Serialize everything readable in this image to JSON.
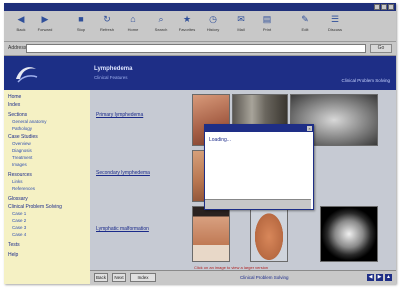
{
  "window": {
    "title": ""
  },
  "toolbar": {
    "buttons": [
      {
        "label": "Back",
        "icon": "back-arrow-icon"
      },
      {
        "label": "Forward",
        "icon": "forward-arrow-icon"
      },
      {
        "label": "Stop",
        "icon": "stop-icon"
      },
      {
        "label": "Refresh",
        "icon": "refresh-icon"
      },
      {
        "label": "Home",
        "icon": "home-icon"
      },
      {
        "label": "Search",
        "icon": "search-icon"
      },
      {
        "label": "Favorites",
        "icon": "favorites-icon"
      },
      {
        "label": "History",
        "icon": "history-icon"
      },
      {
        "label": "Mail",
        "icon": "mail-icon"
      },
      {
        "label": "Print",
        "icon": "print-icon"
      },
      {
        "label": "Edit",
        "icon": "edit-icon"
      },
      {
        "label": "Discuss",
        "icon": "discuss-icon"
      }
    ]
  },
  "address": {
    "label": "Address",
    "value": "",
    "go_label": "Go"
  },
  "sidebar": {
    "items": [
      {
        "label": "Home",
        "sub": false
      },
      {
        "label": "Index",
        "sub": false
      },
      {
        "label": "Sections",
        "sub": false
      },
      {
        "label": "General anatomy",
        "sub": true
      },
      {
        "label": "Pathology",
        "sub": true
      },
      {
        "label": "Case Studies",
        "sub": false
      },
      {
        "label": "Overview",
        "sub": true
      },
      {
        "label": "Diagnosis",
        "sub": true
      },
      {
        "label": "Treatment",
        "sub": true
      },
      {
        "label": "Images",
        "sub": true
      },
      {
        "label": "Resources",
        "sub": false
      },
      {
        "label": "Links",
        "sub": true
      },
      {
        "label": "References",
        "sub": true
      },
      {
        "label": "Glossary",
        "sub": false
      },
      {
        "label": "Clinical Problem Solving",
        "sub": false
      },
      {
        "label": "Case 1",
        "sub": true
      },
      {
        "label": "Case 2",
        "sub": true
      },
      {
        "label": "Case 3",
        "sub": true
      },
      {
        "label": "Case 4",
        "sub": true
      },
      {
        "label": "Tests",
        "sub": false
      },
      {
        "label": "Help",
        "sub": false
      }
    ]
  },
  "header": {
    "title": "Lymphedema",
    "subtitle": "Clinical Features",
    "link": "Clinical Problem Solving"
  },
  "main": {
    "rows": [
      {
        "link": "Primary lymphedema"
      },
      {
        "link": "Secondary lymphedema"
      },
      {
        "link": "Lymphatic malformation"
      }
    ],
    "caption": "Click on an image to view a larger version"
  },
  "popup": {
    "text": "Loading..."
  },
  "bottombar": {
    "btn1": "Back",
    "btn2": "Next",
    "btn3": "Index",
    "nav_text": "Clinical Problem Solving"
  }
}
